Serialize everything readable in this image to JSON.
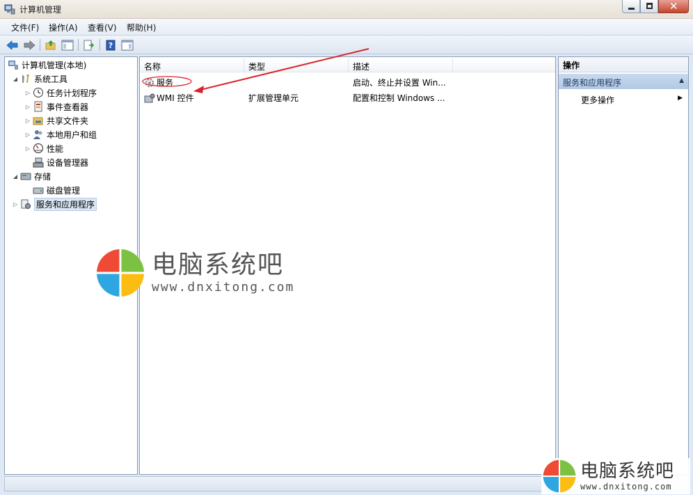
{
  "window": {
    "title": "计算机管理"
  },
  "menu": {
    "items": [
      "文件(F)",
      "操作(A)",
      "查看(V)",
      "帮助(H)"
    ]
  },
  "toolbar": {
    "buttons": [
      "back-arrow-icon",
      "forward-arrow-icon",
      "up-folder-icon",
      "show-tree-icon",
      "export-list-icon",
      "help-icon",
      "action-pane-icon"
    ]
  },
  "tree": {
    "root": "计算机管理(本地)",
    "system_tools": "系统工具",
    "task_scheduler": "任务计划程序",
    "event_viewer": "事件查看器",
    "shared_folders": "共享文件夹",
    "local_users": "本地用户和组",
    "performance": "性能",
    "device_manager": "设备管理器",
    "storage": "存储",
    "disk_management": "磁盘管理",
    "services_apps": "服务和应用程序"
  },
  "list": {
    "columns": [
      "名称",
      "类型",
      "描述"
    ],
    "rows": [
      {
        "name": "服务",
        "type": "",
        "desc": "启动、终止并设置 Win..."
      },
      {
        "name": "WMI 控件",
        "type": "扩展管理单元",
        "desc": "配置和控制 Windows ..."
      }
    ]
  },
  "actions": {
    "title": "操作",
    "section": "服务和应用程序",
    "more": "更多操作"
  },
  "watermark": {
    "title": "电脑系统吧",
    "url": "www.dnxitong.com"
  },
  "colors": {
    "annotation": "#d9232a",
    "logo_red": "#ee4a35",
    "logo_green": "#7dc142",
    "logo_blue": "#2ea7e0",
    "logo_yellow": "#fbbd12"
  }
}
